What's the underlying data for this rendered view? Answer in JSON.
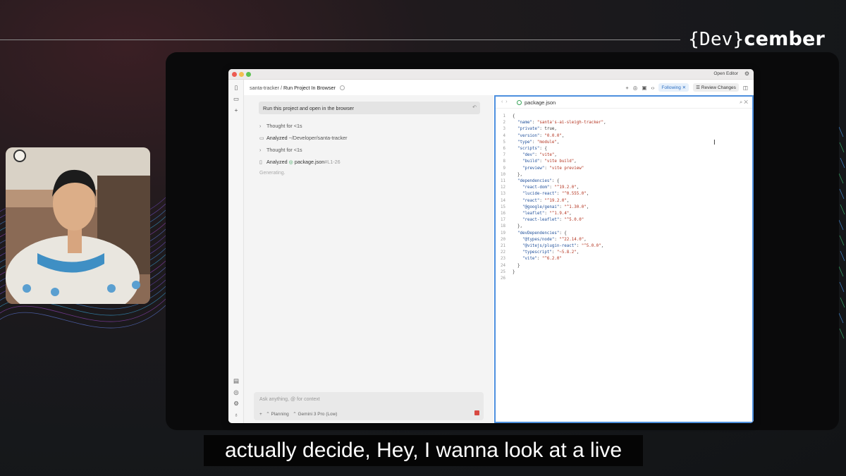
{
  "brand": {
    "dev": "{Dev}",
    "rest": "cember"
  },
  "window": {
    "open_editor": "Open Editor",
    "icons": {
      "settings": "gear-icon"
    }
  },
  "toolbar": {
    "project": "santa-tracker",
    "separator": "/",
    "task": "Run Project In Browser",
    "following": "Following ✕",
    "review": "Review Changes"
  },
  "chat": {
    "prompt": "Run this project and open in the browser",
    "steps": [
      {
        "label": "Thought for <1s"
      },
      {
        "label": "Analyzed",
        "detail": "~/Developer/santa-tracker"
      },
      {
        "label": "Thought for <1s"
      },
      {
        "label": "Analyzed",
        "file": "package.json",
        "range": "#L1-26"
      }
    ],
    "status": "Generating.",
    "composer": {
      "placeholder": "Ask anything, @ for context",
      "mode": "Planning",
      "model": "Gemini 3 Pro (Low)"
    }
  },
  "editor": {
    "filename": "package.json",
    "lines": [
      [
        {
          "t": "{",
          "c": ""
        }
      ],
      [
        {
          "t": "  ",
          "c": ""
        },
        {
          "t": "\"name\"",
          "c": "k"
        },
        {
          "t": ": ",
          "c": ""
        },
        {
          "t": "\"santa's-ai-sleigh-tracker\"",
          "c": "s"
        },
        {
          "t": ",",
          "c": ""
        }
      ],
      [
        {
          "t": "  ",
          "c": ""
        },
        {
          "t": "\"private\"",
          "c": "k"
        },
        {
          "t": ": true,",
          "c": ""
        }
      ],
      [
        {
          "t": "  ",
          "c": ""
        },
        {
          "t": "\"version\"",
          "c": "k"
        },
        {
          "t": ": ",
          "c": ""
        },
        {
          "t": "\"0.0.0\"",
          "c": "s"
        },
        {
          "t": ",",
          "c": ""
        }
      ],
      [
        {
          "t": "  ",
          "c": ""
        },
        {
          "t": "\"type\"",
          "c": "k"
        },
        {
          "t": ": ",
          "c": ""
        },
        {
          "t": "\"module\"",
          "c": "s"
        },
        {
          "t": ",",
          "c": ""
        }
      ],
      [
        {
          "t": "  ",
          "c": ""
        },
        {
          "t": "\"scripts\"",
          "c": "k"
        },
        {
          "t": ": {",
          "c": ""
        }
      ],
      [
        {
          "t": "    ",
          "c": ""
        },
        {
          "t": "\"dev\"",
          "c": "k"
        },
        {
          "t": ": ",
          "c": ""
        },
        {
          "t": "\"vite\"",
          "c": "s"
        },
        {
          "t": ",",
          "c": ""
        }
      ],
      [
        {
          "t": "    ",
          "c": ""
        },
        {
          "t": "\"build\"",
          "c": "k"
        },
        {
          "t": ": ",
          "c": ""
        },
        {
          "t": "\"vite build\"",
          "c": "s"
        },
        {
          "t": ",",
          "c": ""
        }
      ],
      [
        {
          "t": "    ",
          "c": ""
        },
        {
          "t": "\"preview\"",
          "c": "k"
        },
        {
          "t": ": ",
          "c": ""
        },
        {
          "t": "\"vite preview\"",
          "c": "s"
        }
      ],
      [
        {
          "t": "  },",
          "c": ""
        }
      ],
      [
        {
          "t": "  ",
          "c": ""
        },
        {
          "t": "\"dependencies\"",
          "c": "k"
        },
        {
          "t": ": {",
          "c": ""
        }
      ],
      [
        {
          "t": "    ",
          "c": ""
        },
        {
          "t": "\"react-dom\"",
          "c": "k"
        },
        {
          "t": ": ",
          "c": ""
        },
        {
          "t": "\"^19.2.0\"",
          "c": "s"
        },
        {
          "t": ",",
          "c": ""
        }
      ],
      [
        {
          "t": "    ",
          "c": ""
        },
        {
          "t": "\"lucide-react\"",
          "c": "k"
        },
        {
          "t": ": ",
          "c": ""
        },
        {
          "t": "\"^0.555.0\"",
          "c": "s"
        },
        {
          "t": ",",
          "c": ""
        }
      ],
      [
        {
          "t": "    ",
          "c": ""
        },
        {
          "t": "\"react\"",
          "c": "k"
        },
        {
          "t": ": ",
          "c": ""
        },
        {
          "t": "\"^19.2.0\"",
          "c": "s"
        },
        {
          "t": ",",
          "c": ""
        }
      ],
      [
        {
          "t": "    ",
          "c": ""
        },
        {
          "t": "\"@google/genai\"",
          "c": "k"
        },
        {
          "t": ": ",
          "c": ""
        },
        {
          "t": "\"^1.30.0\"",
          "c": "s"
        },
        {
          "t": ",",
          "c": ""
        }
      ],
      [
        {
          "t": "    ",
          "c": ""
        },
        {
          "t": "\"leaflet\"",
          "c": "k"
        },
        {
          "t": ": ",
          "c": ""
        },
        {
          "t": "\"^1.9.4\"",
          "c": "s"
        },
        {
          "t": ",",
          "c": ""
        }
      ],
      [
        {
          "t": "    ",
          "c": ""
        },
        {
          "t": "\"react-leaflet\"",
          "c": "k"
        },
        {
          "t": ": ",
          "c": ""
        },
        {
          "t": "\"^5.0.0\"",
          "c": "s"
        }
      ],
      [
        {
          "t": "  },",
          "c": ""
        }
      ],
      [
        {
          "t": "  ",
          "c": ""
        },
        {
          "t": "\"devDependencies\"",
          "c": "k"
        },
        {
          "t": ": {",
          "c": ""
        }
      ],
      [
        {
          "t": "    ",
          "c": ""
        },
        {
          "t": "\"@types/node\"",
          "c": "k"
        },
        {
          "t": ": ",
          "c": ""
        },
        {
          "t": "\"^22.14.0\"",
          "c": "s"
        },
        {
          "t": ",",
          "c": ""
        }
      ],
      [
        {
          "t": "    ",
          "c": ""
        },
        {
          "t": "\"@vitejs/plugin-react\"",
          "c": "k"
        },
        {
          "t": ": ",
          "c": ""
        },
        {
          "t": "\"^5.0.0\"",
          "c": "s"
        },
        {
          "t": ",",
          "c": ""
        }
      ],
      [
        {
          "t": "    ",
          "c": ""
        },
        {
          "t": "\"typescript\"",
          "c": "k"
        },
        {
          "t": ": ",
          "c": ""
        },
        {
          "t": "\"~5.8.2\"",
          "c": "s"
        },
        {
          "t": ",",
          "c": ""
        }
      ],
      [
        {
          "t": "    ",
          "c": ""
        },
        {
          "t": "\"vite\"",
          "c": "k"
        },
        {
          "t": ": ",
          "c": ""
        },
        {
          "t": "\"^6.2.0\"",
          "c": "s"
        }
      ],
      [
        {
          "t": "  }",
          "c": ""
        }
      ],
      [
        {
          "t": "}",
          "c": ""
        }
      ],
      [
        {
          "t": "",
          "c": ""
        }
      ]
    ]
  },
  "caption": "actually decide, Hey, I wanna look at a live",
  "colors": {
    "accent": "#4d8fde",
    "key": "#1f4f9a",
    "string": "#b3331f",
    "stop": "#d84a42"
  }
}
